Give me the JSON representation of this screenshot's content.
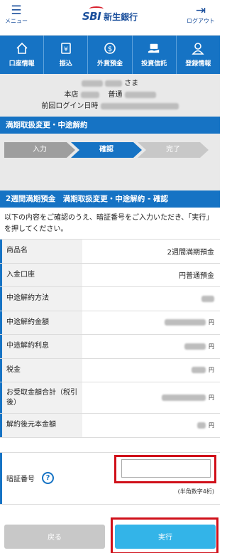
{
  "header": {
    "menu_label": "メニュー",
    "logo_text": "SBI",
    "bank_name": "新生銀行",
    "logout_label": "ログアウト",
    "brand_color": "#1a4f9c",
    "logo_accent_color": "#d81e2c"
  },
  "nav": {
    "items": [
      {
        "label": "口座情報",
        "icon": "house-icon"
      },
      {
        "label": "振込",
        "icon": "transfer-icon"
      },
      {
        "label": "外貨預金",
        "icon": "dollar-coin-icon"
      },
      {
        "label": "投資信託",
        "icon": "investment-icon"
      },
      {
        "label": "登録情報",
        "icon": "user-icon"
      }
    ],
    "color": "#1673c4"
  },
  "user": {
    "suffix": "さま",
    "branch_label": "本店",
    "account_type": "普通",
    "last_login_label": "前回ログイン日時"
  },
  "section_title": "満期取扱変更・中途解約",
  "steps": [
    "入力",
    "確認",
    "完了"
  ],
  "confirm_title": "2週間満期預金　満期取扱変更・中途解約 - 確認",
  "intro_text": "以下の内容をご確認のうえ、暗証番号をご入力いただき、「実行」を押してください。",
  "rows": [
    {
      "label": "商品名",
      "value": "2週間満期預金",
      "unit": ""
    },
    {
      "label": "入金口座",
      "value": "円普通預金",
      "unit": ""
    },
    {
      "label": "中途解約方法",
      "value": "",
      "unit": ""
    },
    {
      "label": "中途解約金額",
      "value": "",
      "unit": "円"
    },
    {
      "label": "中途解約利息",
      "value": "",
      "unit": "円"
    },
    {
      "label": "税金",
      "value": "",
      "unit": "円"
    },
    {
      "label": "お受取金額合計（税引後）",
      "value": "",
      "unit": "円"
    },
    {
      "label": "解約後元本金額",
      "value": "",
      "unit": "円"
    }
  ],
  "pin": {
    "label": "暗証番号",
    "help_icon": "?",
    "note": "(半角数字4桁)",
    "value": ""
  },
  "buttons": {
    "back": "戻る",
    "execute": "実行"
  },
  "highlight_color": "#d0101a"
}
